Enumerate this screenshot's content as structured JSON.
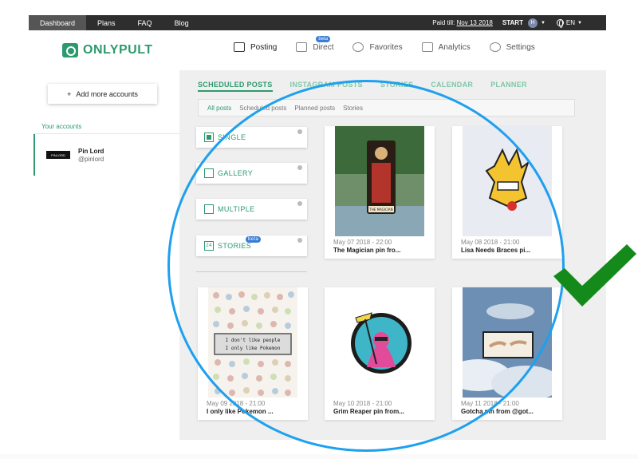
{
  "topbar": {
    "nav": [
      "Dashboard",
      "Plans",
      "FAQ",
      "Blog"
    ],
    "paid_label": "Paid till:",
    "paid_date": "Nov 13 2018",
    "start": "START",
    "user_initial": "H",
    "lang": "EN"
  },
  "header": {
    "logo": "ONLYPULT",
    "nav": [
      {
        "label": "Posting",
        "icon": "posting-icon"
      },
      {
        "label": "Direct",
        "icon": "direct-icon",
        "badge": "beta"
      },
      {
        "label": "Favorites",
        "icon": "star-icon"
      },
      {
        "label": "Analytics",
        "icon": "analytics-icon"
      },
      {
        "label": "Settings",
        "icon": "gear-icon"
      }
    ]
  },
  "sidebar": {
    "add_button": "Add more accounts",
    "your_accounts": "Your accounts",
    "account": {
      "name": "Pin Lord",
      "handle": "@pinlord",
      "avatar_text": "PINLORD"
    }
  },
  "content": {
    "subtabs": [
      "SCHEDULED POSTS",
      "INSTAGRAM POSTS",
      "STORIES",
      "CALENDAR",
      "PLANNER"
    ],
    "filters": [
      "All posts",
      "Scheduled posts",
      "Planned posts",
      "Stories"
    ],
    "post_types": [
      {
        "label": "SINGLE"
      },
      {
        "label": "GALLERY"
      },
      {
        "label": "MULTIPLE"
      },
      {
        "label": "STORIES",
        "badge": "beta",
        "icon_text": "24"
      }
    ],
    "posts": [
      {
        "date": "May 07 2018 - 22:00",
        "title": "The Magician pin fro..."
      },
      {
        "date": "May 08 2018 - 21:00",
        "title": "Lisa Needs Braces pi..."
      },
      {
        "date": "May 09 2018 - 21:00",
        "title": "I only like Pokemon ..."
      },
      {
        "date": "May 10 2018 - 21:00",
        "title": "Grim Reaper pin from..."
      },
      {
        "date": "May 11 2018 - 21:00",
        "title": "Gotcha pin from @got..."
      }
    ],
    "thumb_texts": {
      "magician": "THE MAGICIAN",
      "pokemon_line1": "I don't like people",
      "pokemon_line2": "I only like Pokemon"
    }
  },
  "colors": {
    "brand": "#2d9a6e",
    "annotation_circle": "#1ea0ef",
    "checkmark": "#138a1a",
    "beta": "#3a7bd5"
  }
}
